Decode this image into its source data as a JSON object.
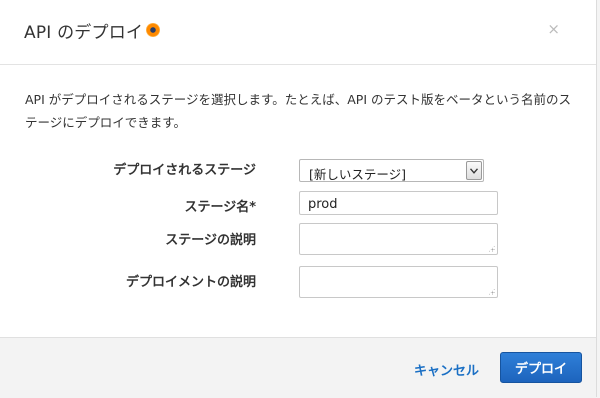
{
  "dialog": {
    "title": "API のデプロイ",
    "info_icon": "info-icon",
    "close_label": "×"
  },
  "description": "API がデプロイされるステージを選択します。たとえば、API のテスト版をベータという名前のステージにデプロイできます。",
  "form": {
    "stage_label": "デプロイされるステージ",
    "stage_selected": "[新しいステージ]",
    "stage_name_label": "ステージ名*",
    "stage_name_value": "prod",
    "stage_description_label": "ステージの説明",
    "stage_description_value": "",
    "deployment_description_label": "デプロイメントの説明",
    "deployment_description_value": ""
  },
  "footer": {
    "cancel_label": "キャンセル",
    "deploy_label": "デプロイ"
  },
  "colors": {
    "primary_button": "#1d64bd",
    "link": "#1a6fc4"
  }
}
